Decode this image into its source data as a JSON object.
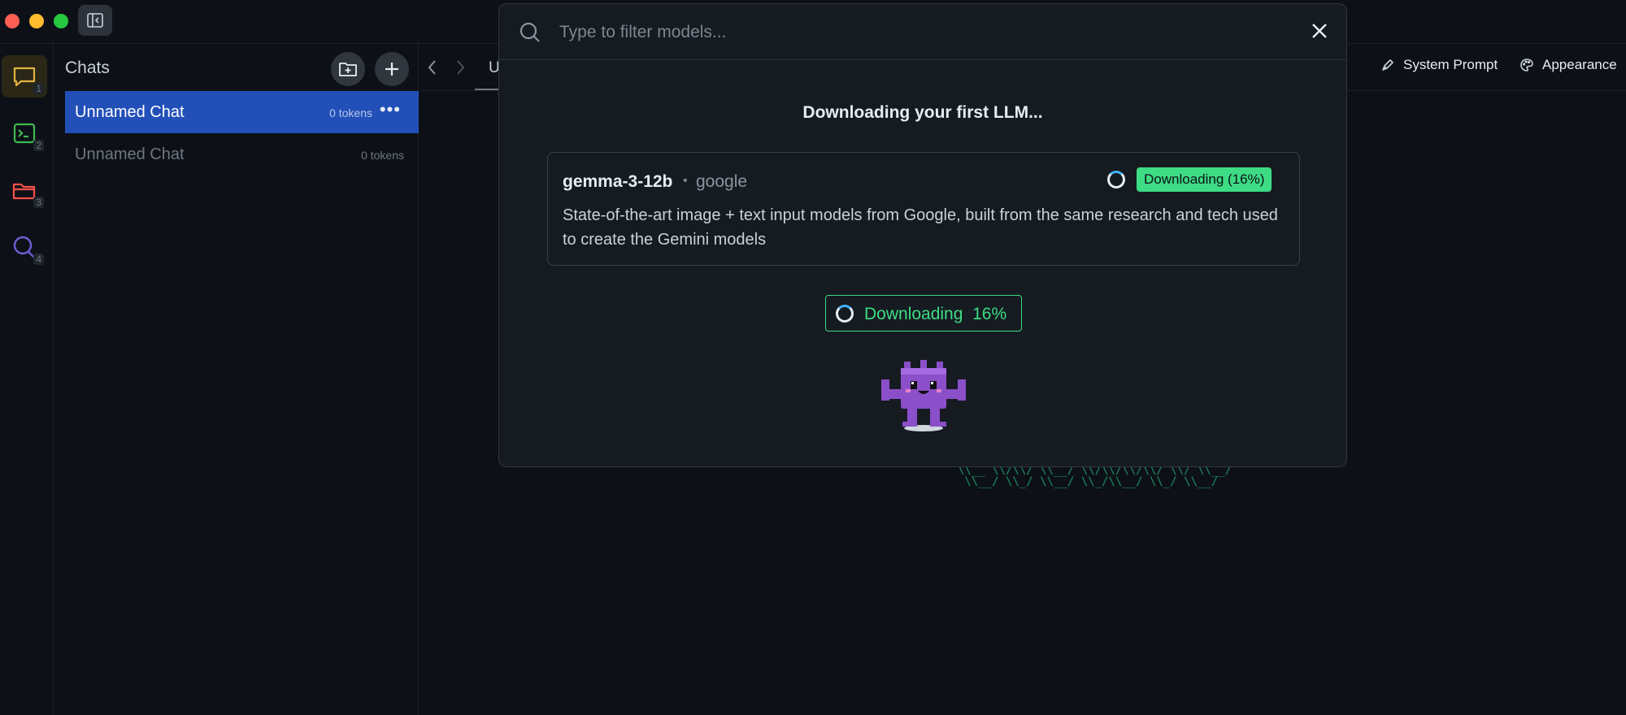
{
  "sidebar": {
    "items": [
      {
        "num": "1",
        "icon": "chat-bubble-icon",
        "color": "#e3b341"
      },
      {
        "num": "2",
        "icon": "terminal-icon",
        "color": "#3fb950"
      },
      {
        "num": "3",
        "icon": "folder-icon",
        "color": "#f85149"
      },
      {
        "num": "4",
        "icon": "search-icon",
        "color": "#6e5fd6"
      }
    ]
  },
  "chats": {
    "title": "Chats",
    "items": [
      {
        "name": "Unnamed Chat",
        "tokens": "0 tokens",
        "selected": true
      },
      {
        "name": "Unnamed Chat",
        "tokens": "0 tokens",
        "selected": false
      }
    ]
  },
  "tabs": {
    "active_fragment": "U"
  },
  "header": {
    "system_prompt": "System Prompt",
    "appearance": "Appearance"
  },
  "modal": {
    "search_placeholder": "Type to filter models...",
    "heading": "Downloading your first LLM...",
    "model": {
      "name": "gemma-3-12b",
      "separator": "•",
      "org": "google",
      "badge": "Downloading (16%)",
      "description": "State-of-the-art image + text input models from Google, built from the same research and tech used to create the Gemini models"
    },
    "status": {
      "label": "Downloading",
      "percent": "16%",
      "progress": 0.16
    }
  },
  "colors": {
    "accent_green": "#3ddc84",
    "selection_blue": "#2250b8",
    "mascot_purple": "#8b4fc9"
  }
}
